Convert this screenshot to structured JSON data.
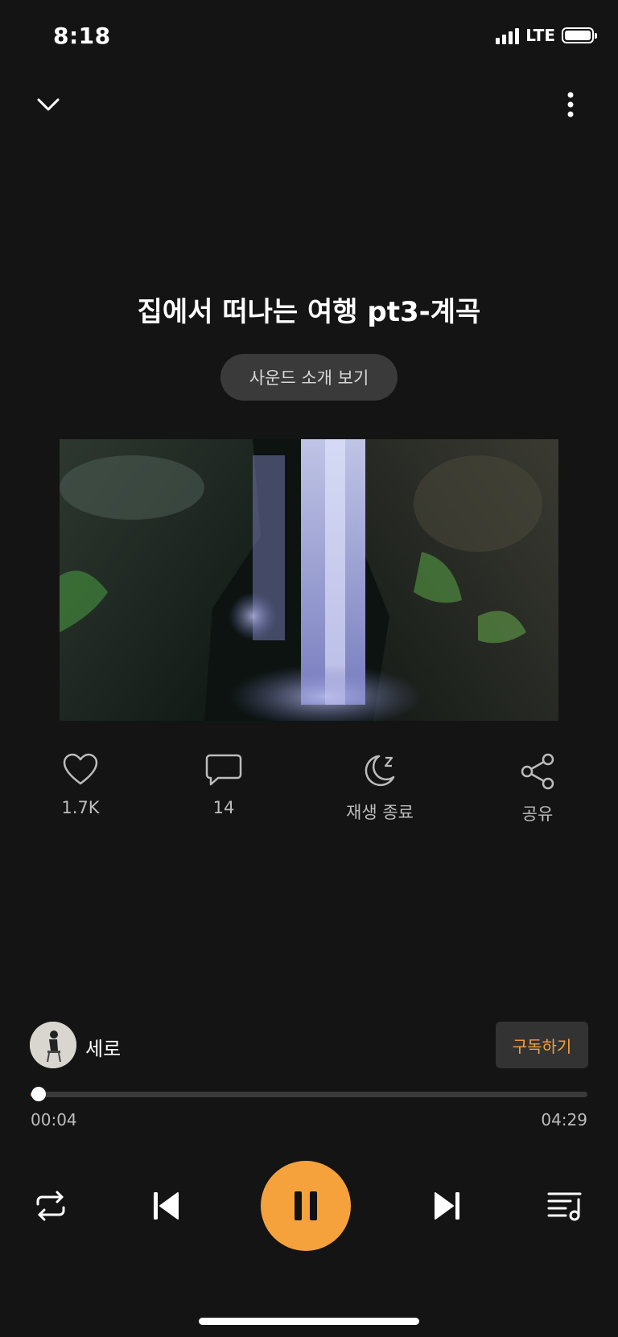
{
  "status": {
    "time": "8:18",
    "network": "LTE",
    "signal_bars": 4,
    "battery_level": 0.9
  },
  "header": {
    "collapse_icon": "chevron-down-icon",
    "menu_icon": "more-vertical-icon"
  },
  "track": {
    "title": "집에서 떠나는 여행 pt3-계곡",
    "intro_label": "사운드 소개 보기"
  },
  "actions": {
    "like": {
      "label": "1.7K",
      "icon": "heart-icon"
    },
    "comment": {
      "label": "14",
      "icon": "comment-icon"
    },
    "sleep": {
      "label": "재생 종료",
      "icon": "moon-sleep-icon"
    },
    "share": {
      "label": "공유",
      "icon": "share-icon"
    }
  },
  "creator": {
    "name": "세로",
    "subscribe_label": "구독하기"
  },
  "progress": {
    "current": "00:04",
    "duration": "04:29",
    "fraction": 0.015
  },
  "colors": {
    "accent": "#f5a23c",
    "background": "#141414",
    "chip": "#3a3a3a"
  }
}
